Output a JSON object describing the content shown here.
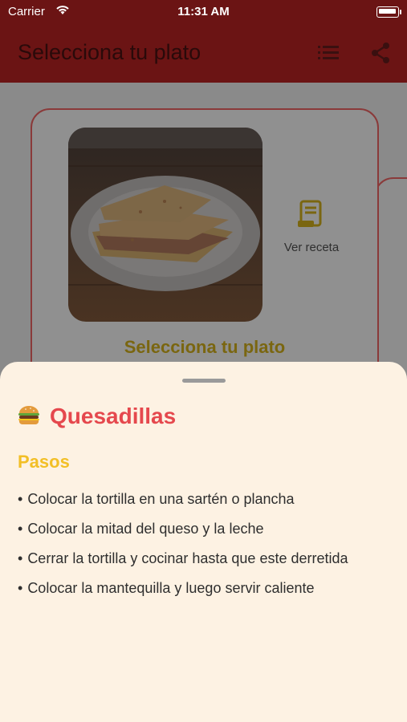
{
  "status_bar": {
    "carrier": "Carrier",
    "time": "11:31 AM"
  },
  "app_bar": {
    "title": "Selecciona tu plato",
    "list_icon": "list-icon",
    "share_icon": "share-icon"
  },
  "colors": {
    "app_bar": "#6b1414",
    "sheet_background": "#fdf2e3",
    "dish_title": "#e5484d",
    "steps_heading": "#f2bf26",
    "card_border": "#8a3a3a"
  },
  "card": {
    "image_alt": "Quesadillas",
    "recipe_icon": "receipt-icon",
    "recipe_label": "Ver receta",
    "title": "Selecciona tu plato"
  },
  "sheet": {
    "emoji_icon": "burger-icon",
    "dish_name": "Quesadillas",
    "steps_heading": "Pasos",
    "steps": [
      "Colocar la tortilla en una sartén o plancha",
      "Colocar la mitad del queso y la leche",
      "Cerrar la tortilla y cocinar hasta que este derretida",
      "Colocar la mantequilla y luego servir caliente"
    ]
  }
}
